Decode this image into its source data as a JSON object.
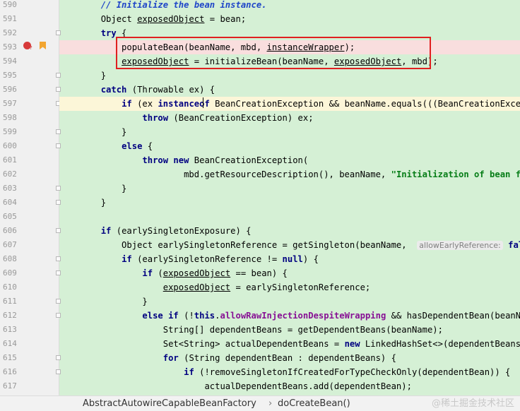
{
  "editor": {
    "lines": [
      {
        "n": "590",
        "segs": [
          {
            "t": "        "
          },
          {
            "t": "// Initialize the bean instance.",
            "c": "cm"
          }
        ]
      },
      {
        "n": "591",
        "segs": [
          {
            "t": "        Object "
          },
          {
            "t": "exposedObject",
            "c": "ul"
          },
          {
            "t": " = bean;"
          }
        ]
      },
      {
        "n": "592",
        "segs": [
          {
            "t": "        "
          },
          {
            "t": "try",
            "c": "kw"
          },
          {
            "t": " {"
          }
        ]
      },
      {
        "n": "593",
        "segs": [
          {
            "t": "            populateBean(beanName, mbd, "
          },
          {
            "t": "instanceWrapper",
            "c": "ul"
          },
          {
            "t": ");"
          }
        ]
      },
      {
        "n": "594",
        "segs": [
          {
            "t": "            "
          },
          {
            "t": "exposedObject",
            "c": "ul"
          },
          {
            "t": " = initializeBean(beanName, "
          },
          {
            "t": "exposedObject",
            "c": "ul"
          },
          {
            "t": ", mbd);"
          }
        ]
      },
      {
        "n": "595",
        "segs": [
          {
            "t": "        }"
          }
        ]
      },
      {
        "n": "596",
        "segs": [
          {
            "t": "        "
          },
          {
            "t": "catch",
            "c": "kw"
          },
          {
            "t": " (Throwable ex) {"
          }
        ]
      },
      {
        "n": "597",
        "segs": [
          {
            "t": "            "
          },
          {
            "t": "if",
            "c": "kw"
          },
          {
            "t": " (ex "
          },
          {
            "t": "instanceof",
            "c": "kw"
          },
          {
            "t": " BeanCreationException && beanName.equals(((BeanCreationExceptio"
          }
        ]
      },
      {
        "n": "598",
        "segs": [
          {
            "t": "                "
          },
          {
            "t": "throw",
            "c": "kw"
          },
          {
            "t": " (BeanCreationException) ex;"
          }
        ]
      },
      {
        "n": "599",
        "segs": [
          {
            "t": "            }"
          }
        ]
      },
      {
        "n": "600",
        "segs": [
          {
            "t": "            "
          },
          {
            "t": "else",
            "c": "kw"
          },
          {
            "t": " {"
          }
        ]
      },
      {
        "n": "601",
        "segs": [
          {
            "t": "                "
          },
          {
            "t": "throw new",
            "c": "kw"
          },
          {
            "t": " BeanCreationException("
          }
        ]
      },
      {
        "n": "602",
        "segs": [
          {
            "t": "                        mbd.getResourceDescription(), beanName, "
          },
          {
            "t": "\"Initialization of bean faile",
            "c": "str"
          }
        ]
      },
      {
        "n": "603",
        "segs": [
          {
            "t": "            }"
          }
        ]
      },
      {
        "n": "604",
        "segs": [
          {
            "t": "        }"
          }
        ]
      },
      {
        "n": "605",
        "segs": [
          {
            "t": ""
          }
        ]
      },
      {
        "n": "606",
        "segs": [
          {
            "t": "        "
          },
          {
            "t": "if",
            "c": "kw"
          },
          {
            "t": " (earlySingletonExposure) {"
          }
        ]
      },
      {
        "n": "607",
        "segs": [
          {
            "t": "            Object earlySingletonReference = getSingleton(beanName,  "
          },
          {
            "t": "allowEarlyReference:",
            "c": "hint"
          },
          {
            "t": " "
          },
          {
            "t": "false",
            "c": "kw"
          },
          {
            "t": ")"
          }
        ]
      },
      {
        "n": "608",
        "segs": [
          {
            "t": "            "
          },
          {
            "t": "if",
            "c": "kw"
          },
          {
            "t": " (earlySingletonReference != "
          },
          {
            "t": "null",
            "c": "kw"
          },
          {
            "t": ") {"
          }
        ]
      },
      {
        "n": "609",
        "segs": [
          {
            "t": "                "
          },
          {
            "t": "if",
            "c": "kw"
          },
          {
            "t": " ("
          },
          {
            "t": "exposedObject",
            "c": "ul"
          },
          {
            "t": " == bean) {"
          }
        ]
      },
      {
        "n": "610",
        "segs": [
          {
            "t": "                    "
          },
          {
            "t": "exposedObject",
            "c": "ul"
          },
          {
            "t": " = earlySingletonReference;"
          }
        ]
      },
      {
        "n": "611",
        "segs": [
          {
            "t": "                }"
          }
        ]
      },
      {
        "n": "612",
        "segs": [
          {
            "t": "                "
          },
          {
            "t": "else if",
            "c": "kw"
          },
          {
            "t": " (!"
          },
          {
            "t": "this",
            "c": "kw"
          },
          {
            "t": "."
          },
          {
            "t": "allowRawInjectionDespiteWrapping",
            "c": "fld"
          },
          {
            "t": " && hasDependentBean(beanName"
          }
        ]
      },
      {
        "n": "613",
        "segs": [
          {
            "t": "                    String[] dependentBeans = getDependentBeans(beanName);"
          }
        ]
      },
      {
        "n": "614",
        "segs": [
          {
            "t": "                    Set<String> actualDependentBeans = "
          },
          {
            "t": "new",
            "c": "kw"
          },
          {
            "t": " LinkedHashSet<>(dependentBeans.len"
          }
        ]
      },
      {
        "n": "615",
        "segs": [
          {
            "t": "                    "
          },
          {
            "t": "for",
            "c": "kw"
          },
          {
            "t": " (String dependentBean : dependentBeans) {"
          }
        ]
      },
      {
        "n": "616",
        "segs": [
          {
            "t": "                        "
          },
          {
            "t": "if",
            "c": "kw"
          },
          {
            "t": " (!removeSingletonIfCreatedForTypeCheckOnly(dependentBean)) {"
          }
        ]
      },
      {
        "n": "617",
        "segs": [
          {
            "t": "                            actualDependentBeans.add(dependentBean);"
          }
        ]
      }
    ]
  },
  "breadcrumb": {
    "class_name": "AbstractAutowireCapableBeanFactory",
    "separator": "›",
    "method_name": "doCreateBean()"
  },
  "watermark": "@稀土掘金技术社区",
  "gutter_icons": {
    "breakpoint": "breakpoint-icon",
    "breakpoint_badge": "?",
    "bookmark": "bookmark-icon"
  },
  "colors": {
    "code_background": "#d5f0d5",
    "highlight_line": "#f9dede",
    "current_line": "#fcf6d8",
    "selection_box": "#e02020",
    "keyword": "#000080",
    "comment": "#1f46c8",
    "string": "#067d17"
  }
}
